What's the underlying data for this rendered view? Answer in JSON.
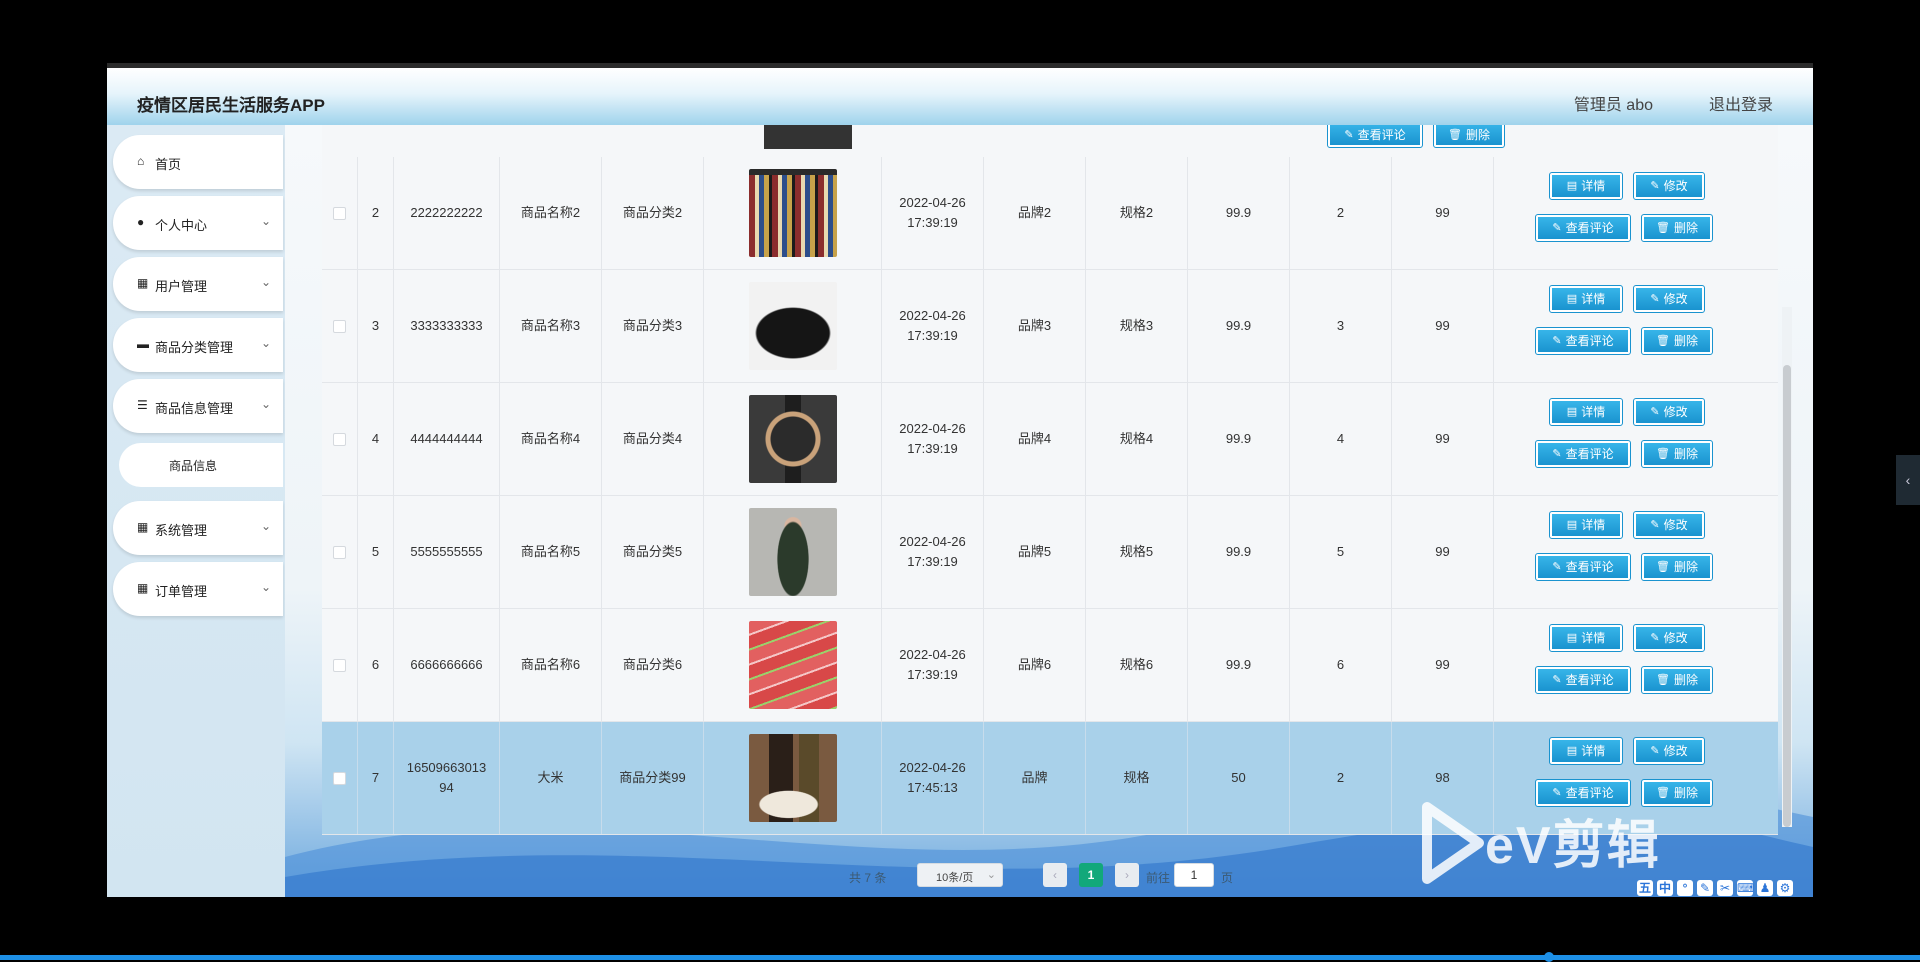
{
  "app": {
    "title": "疫情区居民生活服务APP",
    "admin_label": "管理员 abo",
    "logout_label": "退出登录"
  },
  "sidebar": {
    "items": [
      {
        "label": "首页",
        "icon": "home-icon"
      },
      {
        "label": "个人中心",
        "icon": "user-icon"
      },
      {
        "label": "用户管理",
        "icon": "grid-icon"
      },
      {
        "label": "商品分类管理",
        "icon": "monitor-icon"
      },
      {
        "label": "商品信息管理",
        "icon": "list-icon"
      },
      {
        "label": "系统管理",
        "icon": "grid-icon"
      },
      {
        "label": "订单管理",
        "icon": "grid-icon"
      }
    ],
    "sub_item": "商品信息"
  },
  "table": {
    "buttons": {
      "detail": "详情",
      "edit": "修改",
      "comments": "查看评论",
      "delete": "删除"
    },
    "rows": [
      {
        "index": "2",
        "code": "2222222222",
        "name": "商品名称2",
        "category": "商品分类2",
        "time": "2022-04-26 17:39:19",
        "brand": "品牌2",
        "spec": "规格2",
        "price": "99.9",
        "count": "2",
        "stock": "99",
        "image": "bookshelf"
      },
      {
        "index": "3",
        "code": "3333333333",
        "name": "商品名称3",
        "category": "商品分类3",
        "time": "2022-04-26 17:39:19",
        "brand": "品牌3",
        "spec": "规格3",
        "price": "99.9",
        "count": "3",
        "stock": "99",
        "image": "handbag"
      },
      {
        "index": "4",
        "code": "4444444444",
        "name": "商品名称4",
        "category": "商品分类4",
        "time": "2022-04-26 17:39:19",
        "brand": "品牌4",
        "spec": "规格4",
        "price": "99.9",
        "count": "4",
        "stock": "99",
        "image": "watch"
      },
      {
        "index": "5",
        "code": "5555555555",
        "name": "商品名称5",
        "category": "商品分类5",
        "time": "2022-04-26 17:39:19",
        "brand": "品牌5",
        "spec": "规格5",
        "price": "99.9",
        "count": "5",
        "stock": "99",
        "image": "dress"
      },
      {
        "index": "6",
        "code": "6666666666",
        "name": "商品名称6",
        "category": "商品分类6",
        "time": "2022-04-26 17:39:19",
        "brand": "品牌6",
        "spec": "规格6",
        "price": "99.9",
        "count": "6",
        "stock": "99",
        "image": "sausages"
      },
      {
        "index": "7",
        "code": "1650966301394",
        "name": "大米",
        "category": "商品分类99",
        "time": "2022-04-26 17:45:13",
        "brand": "品牌",
        "spec": "规格",
        "price": "50",
        "count": "2",
        "stock": "98",
        "image": "rice"
      }
    ]
  },
  "pager": {
    "total": "共 7 条",
    "page_size": "10条/页",
    "prev": "‹",
    "current": "1",
    "next": "›",
    "goto": "前往",
    "goto_value": "1",
    "page_unit": "页"
  },
  "watermark": {
    "text": "eV剪辑"
  },
  "colors": {
    "accent": "#1a93cf",
    "selected_row": "#a9d1ea",
    "pager_current": "#12a87a"
  }
}
